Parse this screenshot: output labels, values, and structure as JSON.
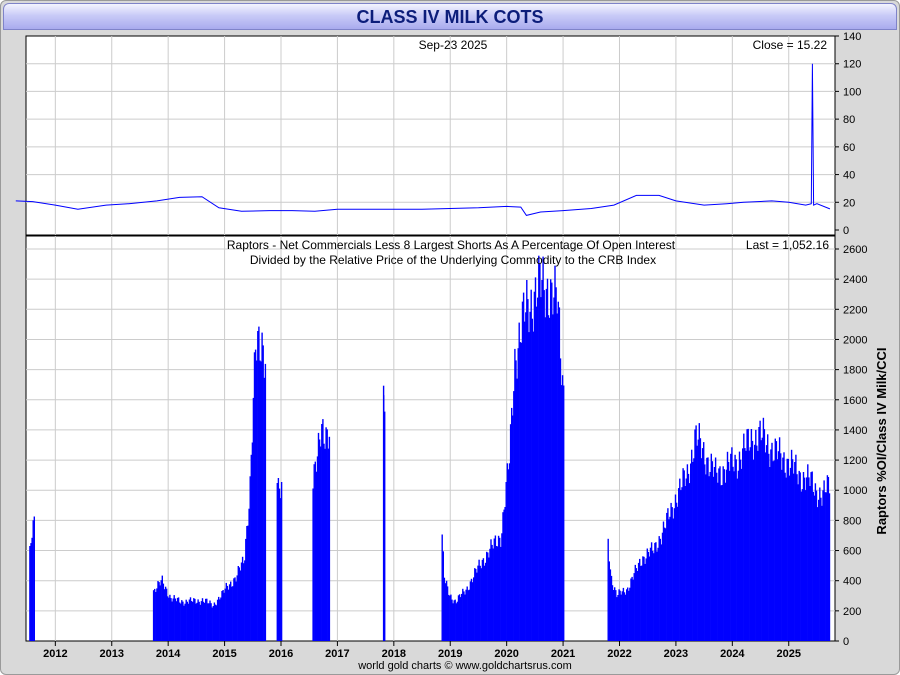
{
  "title": "CLASS IV MILK COTS",
  "footer": "world gold charts © www.goldchartsrus.com",
  "colors": {
    "series": "#0000ff",
    "grid": "#cccccc"
  },
  "chart_data": [
    {
      "type": "line",
      "panel": "top",
      "date_label": "Sep-23  2025",
      "close_label": "Close = 15.22",
      "ylim": [
        0,
        140
      ],
      "yticks": [
        0,
        20,
        40,
        60,
        80,
        100,
        120,
        140
      ],
      "grid": true,
      "x": [
        2011.3,
        2011.6,
        2012.0,
        2012.4,
        2012.9,
        2013.3,
        2013.8,
        2014.2,
        2014.6,
        2014.9,
        2015.3,
        2015.8,
        2016.2,
        2016.6,
        2017.0,
        2017.3,
        2017.7,
        2018.0,
        2018.5,
        2019.0,
        2019.5,
        2020.0,
        2020.25,
        2020.35,
        2020.6,
        2021.0,
        2021.5,
        2021.9,
        2022.3,
        2022.7,
        2023.0,
        2023.5,
        2023.9,
        2024.2,
        2024.7,
        2025.0,
        2025.3,
        2025.4,
        2025.42,
        2025.44,
        2025.5,
        2025.73
      ],
      "y": [
        21,
        20.5,
        18,
        15,
        18,
        19,
        21,
        23.5,
        24,
        16,
        13.5,
        14,
        14,
        13.5,
        15,
        15,
        15,
        15,
        15,
        15.5,
        16,
        17,
        16.5,
        10.5,
        13,
        14,
        15.5,
        18,
        25,
        25,
        21,
        18,
        19,
        20,
        21,
        20,
        18,
        19,
        120,
        18,
        19,
        15.22
      ]
    },
    {
      "type": "bar",
      "panel": "bottom",
      "title": "Raptors - Net Commercials Less 8 Largest Shorts As A Percentage Of Open Interest",
      "subtitle": "Divided by the Relative Price of the Underlying Commodity to the CRB Index",
      "last_label": "Last = 1,052.16",
      "ylabel": "Raptors %OI/Class IV Milk/CCI",
      "ylim": [
        0,
        2600
      ],
      "yticks": [
        0,
        200,
        400,
        600,
        800,
        1000,
        1200,
        1400,
        1600,
        1800,
        2000,
        2200,
        2400,
        2600
      ],
      "grid": true,
      "x_years": [
        "2012",
        "2013",
        "2014",
        "2015",
        "2016",
        "2017",
        "2018",
        "2019",
        "2020",
        "2021",
        "2022",
        "2023",
        "2024",
        "2025"
      ],
      "x_range": [
        2011.48,
        2025.82
      ],
      "anchors_x": [
        2011.55,
        2011.6,
        2011.63,
        2013.75,
        2013.9,
        2014.05,
        2014.3,
        2014.6,
        2014.8,
        2014.95,
        2015.05,
        2015.2,
        2015.35,
        2015.45,
        2015.55,
        2015.62,
        2015.68,
        2015.72,
        2015.95,
        2016.0,
        2016.55,
        2016.65,
        2016.72,
        2016.8,
        2016.85,
        2017.82,
        2018.85,
        2018.9,
        2019.0,
        2019.1,
        2019.3,
        2019.55,
        2019.7,
        2019.9,
        2020.05,
        2020.15,
        2020.25,
        2020.35,
        2020.5,
        2020.6,
        2020.75,
        2020.85,
        2020.9,
        2021.0,
        2021.8,
        2021.85,
        2021.95,
        2022.15,
        2022.4,
        2022.6,
        2022.8,
        2023.0,
        2023.2,
        2023.35,
        2023.5,
        2023.7,
        2023.9,
        2024.1,
        2024.35,
        2024.55,
        2024.75,
        2024.95,
        2025.2,
        2025.4,
        2025.6,
        2025.73
      ],
      "anchors_y": [
        580,
        740,
        760,
        330,
        400,
        280,
        260,
        270,
        240,
        300,
        370,
        410,
        550,
        1000,
        1900,
        2000,
        2000,
        1900,
        1050,
        1050,
        1050,
        1200,
        1400,
        1400,
        1400,
        1630,
        720,
        400,
        300,
        260,
        350,
        520,
        600,
        700,
        1200,
        1900,
        2050,
        2200,
        2300,
        2350,
        2350,
        2250,
        2250,
        1700,
        680,
        430,
        300,
        350,
        550,
        600,
        750,
        950,
        1100,
        1350,
        1250,
        1100,
        1150,
        1200,
        1350,
        1350,
        1250,
        1200,
        1100,
        1050,
        950,
        1052.16
      ],
      "gaps": [
        [
          2011.64,
          2013.73
        ],
        [
          2015.73,
          2015.93
        ],
        [
          2016.02,
          2016.55
        ],
        [
          2016.86,
          2017.8
        ],
        [
          2017.84,
          2018.84
        ],
        [
          2021.02,
          2021.79
        ]
      ],
      "last": 1052.16
    }
  ]
}
